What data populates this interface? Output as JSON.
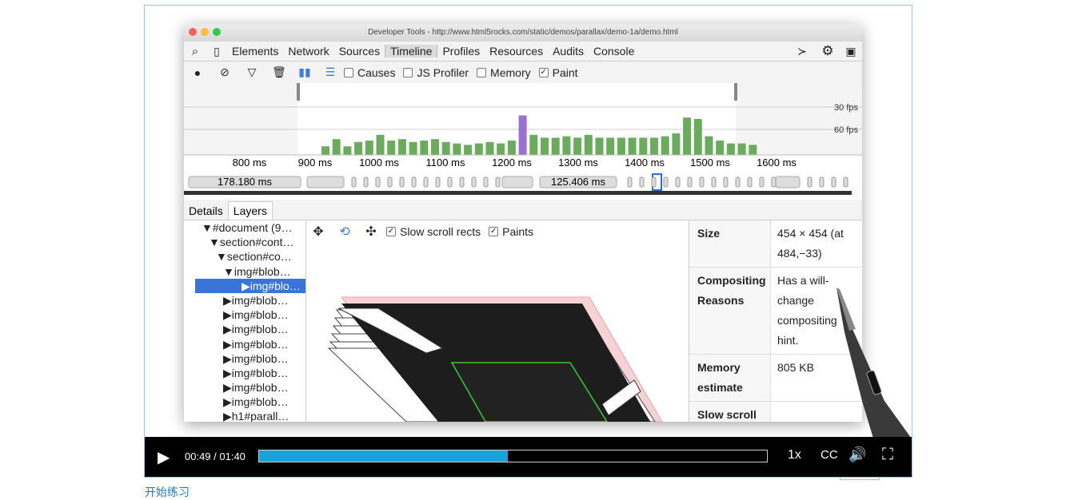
{
  "window": {
    "title": "Developer Tools - http://www.html5rocks.com/static/demos/parallax/demo-1a/demo.html"
  },
  "panel_tabs": [
    "Elements",
    "Network",
    "Sources",
    "Timeline",
    "Profiles",
    "Resources",
    "Audits",
    "Console"
  ],
  "active_tab": "Timeline",
  "toolbar": {
    "checkboxes": [
      {
        "label": "Causes",
        "checked": false
      },
      {
        "label": "JS Profiler",
        "checked": false
      },
      {
        "label": "Memory",
        "checked": false
      },
      {
        "label": "Paint",
        "checked": true
      }
    ]
  },
  "overview": {
    "fps_labels": [
      "30 fps",
      "60 fps"
    ],
    "ticks": [
      "800 ms",
      "900 ms",
      "1000 ms",
      "1100 ms",
      "1200 ms",
      "1300 ms",
      "1400 ms",
      "1500 ms",
      "1600 ms"
    ],
    "durations": [
      "178.180 ms",
      "125.406 ms"
    ],
    "bar_heights": [
      0.12,
      0.22,
      0.12,
      0.18,
      0.2,
      0.28,
      0.2,
      0.22,
      0.18,
      0.2,
      0.22,
      0.18,
      0.16,
      0.14,
      0.16,
      0.18,
      0.16,
      0.2,
      0.55,
      0.28,
      0.24,
      0.24,
      0.26,
      0.24,
      0.28,
      0.24,
      0.24,
      0.24,
      0.24,
      0.24,
      0.24,
      0.26,
      0.3,
      0.52,
      0.5,
      0.26,
      0.2,
      0.16,
      0.16,
      0.14
    ],
    "bar_color": "#6aac5c",
    "purple_color": "#9b6fd4"
  },
  "subtabs": [
    "Details",
    "Layers"
  ],
  "active_subtab": "Layers",
  "tree": [
    "▼#document (9…",
    "▼section#cont…",
    "▼section#co…",
    "▼img#blob…",
    "▶img#blo…",
    "▶img#blob…",
    "▶img#blob…",
    "▶img#blob…",
    "▶img#blob…",
    "▶img#blob…",
    "▶img#blob…",
    "▶img#blob…",
    "▶img#blob…",
    "▶h1#parall…"
  ],
  "selected_tree_index": 4,
  "layer_toolbar": {
    "checkboxes": [
      {
        "label": "Slow scroll rects",
        "checked": true
      },
      {
        "label": "Paints",
        "checked": true
      }
    ]
  },
  "properties": [
    {
      "key": "Size",
      "value": "454 × 454 (at 484,−33)"
    },
    {
      "key": "Compositing Reasons",
      "value": "Has a will-change compositing hint."
    },
    {
      "key": "Memory estimate",
      "value": "805 KB"
    },
    {
      "key": "Slow scroll regions",
      "value": ""
    }
  ],
  "player": {
    "time": "00:49 / 01:40",
    "progress": 0.49,
    "speed": "1x",
    "cc": "CC",
    "accent": "#1aa1d8"
  },
  "link": "开始练习"
}
